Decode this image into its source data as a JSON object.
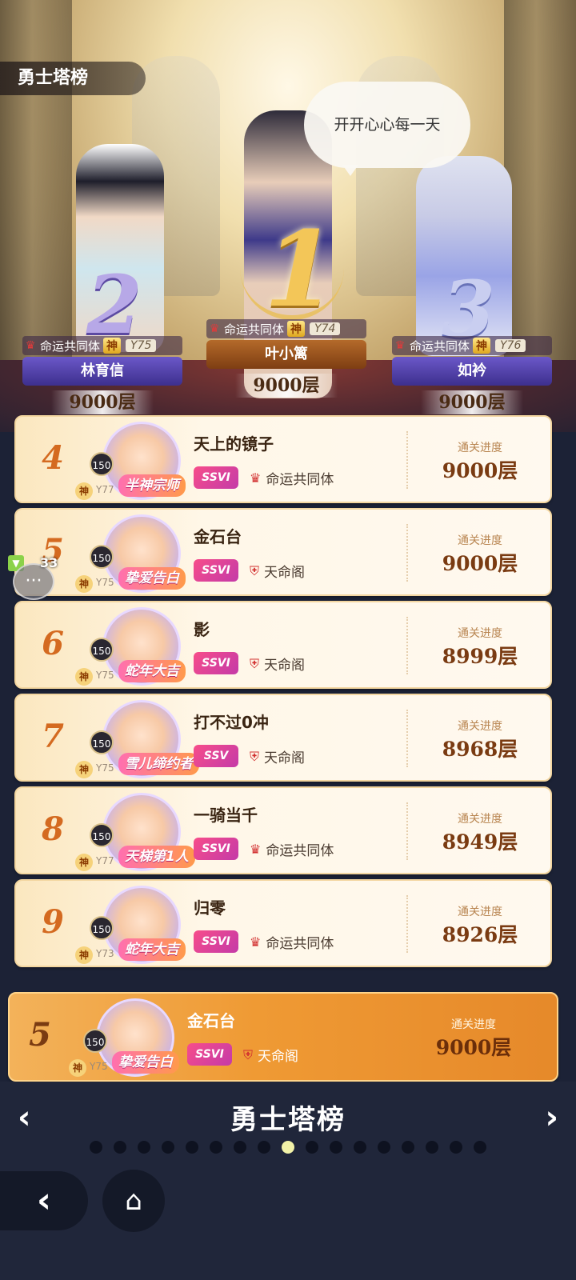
{
  "header": {
    "title": "勇士塔榜"
  },
  "speech_bubble": "开开心心每一天",
  "podium": [
    {
      "rank": "1",
      "guild": "命运共同体",
      "god_tag": "神",
      "level": "Y74",
      "name": "叶小篱",
      "score": "9000层"
    },
    {
      "rank": "2",
      "guild": "命运共同体",
      "god_tag": "神",
      "level": "Y75",
      "name": "林育信",
      "score": "9000层"
    },
    {
      "rank": "3",
      "guild": "命运共同体",
      "god_tag": "神",
      "level": "Y76",
      "name": "如衿",
      "score": "9000层"
    }
  ],
  "progress_label": "通关进度",
  "rows": [
    {
      "rank": "4",
      "avatar_level": "150",
      "god_tag": "神",
      "y_level": "Y77",
      "frame_tag": "半神宗师",
      "name": "天上的镜子",
      "vip": "SSVI",
      "guild": "命运共同体",
      "score": "9000层"
    },
    {
      "rank": "5",
      "avatar_level": "150",
      "god_tag": "神",
      "y_level": "Y75",
      "frame_tag": "挚爱告白",
      "name": "金石台",
      "vip": "SSVI",
      "guild": "天命阁",
      "score": "9000层"
    },
    {
      "rank": "6",
      "avatar_level": "150",
      "god_tag": "神",
      "y_level": "Y75",
      "frame_tag": "蛇年大吉",
      "name": "影",
      "vip": "SSVI",
      "guild": "天命阁",
      "score": "8999层"
    },
    {
      "rank": "7",
      "avatar_level": "150",
      "god_tag": "神",
      "y_level": "Y75",
      "frame_tag": "雪儿缔约者",
      "name": "打不过0冲",
      "vip": "SSV",
      "guild": "天命阁",
      "score": "8968层"
    },
    {
      "rank": "8",
      "avatar_level": "150",
      "god_tag": "神",
      "y_level": "Y77",
      "frame_tag": "天梯第1人",
      "name": "一骑当千",
      "vip": "SSVI",
      "guild": "命运共同体",
      "score": "8949层"
    },
    {
      "rank": "9",
      "avatar_level": "150",
      "god_tag": "神",
      "y_level": "Y73",
      "frame_tag": "蛇年大吉",
      "name": "归零",
      "vip": "SSVI",
      "guild": "命运共同体",
      "score": "8926层"
    }
  ],
  "my_rank": {
    "rank": "5",
    "avatar_level": "150",
    "god_tag": "神",
    "y_level": "Y75",
    "frame_tag": "挚爱告白",
    "name": "金石台",
    "vip": "SSVI",
    "guild": "天命阁",
    "score": "9000层"
  },
  "chat": {
    "count": "33",
    "icon": "chat-bubble-icon"
  },
  "nav": {
    "title": "勇士塔榜",
    "prev": "‹",
    "next": "›",
    "active_page_fraction": 0.5,
    "page_count": 17,
    "active_index": 8
  },
  "bottom": {
    "back_icon": "back-arrow-icon",
    "home_icon": "home-icon"
  },
  "colors": {
    "accent_orange": "#e6892a",
    "rank_orange": "#d46a20",
    "bg_dark": "#20263a"
  }
}
